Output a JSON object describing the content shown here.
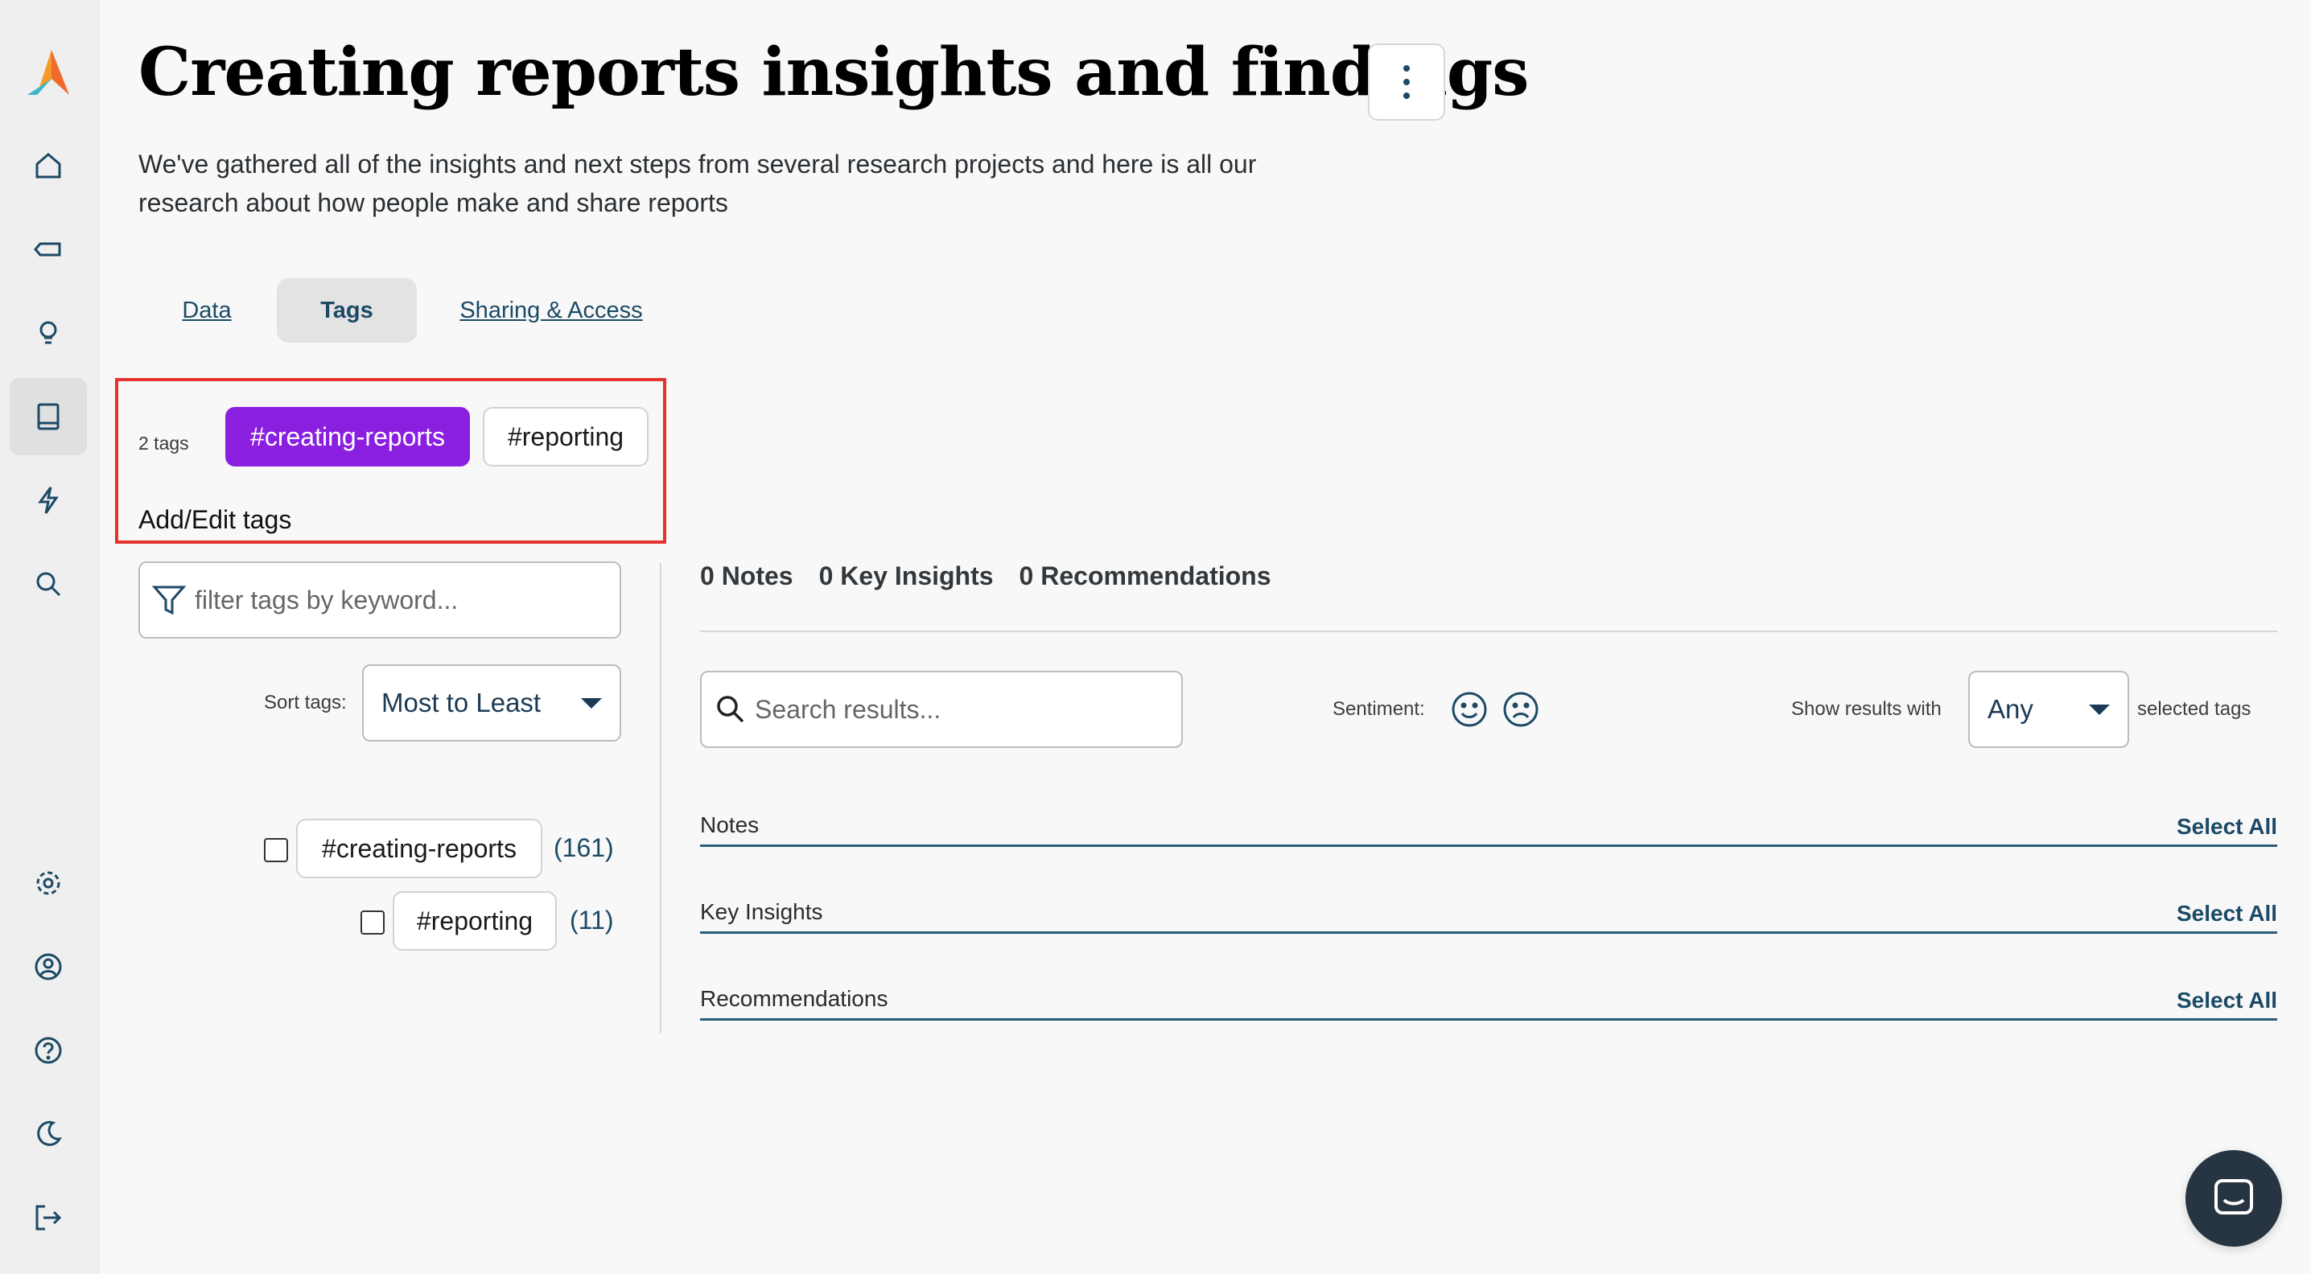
{
  "page": {
    "title": "Creating reports insights and findings",
    "description": "We've gathered all of the insights and next steps from several research projects and here is all our research about how people make and share reports"
  },
  "tabs": [
    {
      "label": "Data"
    },
    {
      "label": "Tags"
    },
    {
      "label": "Sharing & Access"
    }
  ],
  "tag_summary": {
    "count_label": "2 tags",
    "tags": [
      "#creating-reports",
      "#reporting"
    ],
    "add_edit_label": "Add/Edit tags"
  },
  "tag_filter": {
    "placeholder": "filter tags by keyword...",
    "sort_label": "Sort tags:",
    "sort_value": "Most to Least",
    "items": [
      {
        "label": "#creating-reports",
        "count": "(161)"
      },
      {
        "label": "#reporting",
        "count": "(11)"
      }
    ]
  },
  "results": {
    "stats": [
      "0 Notes",
      "0 Key Insights",
      "0 Recommendations"
    ],
    "search_placeholder": "Search results...",
    "sentiment_label": "Sentiment:",
    "show_results_label": "Show results with",
    "show_results_value": "Any",
    "selected_tags_label": "selected tags",
    "sections": [
      {
        "label": "Notes",
        "action": "Select All"
      },
      {
        "label": "Key Insights",
        "action": "Select All"
      },
      {
        "label": "Recommendations",
        "action": "Select All"
      }
    ]
  },
  "colors": {
    "accent_purple": "#8b1fe0",
    "link_blue": "#1c4a66",
    "highlight_red": "#e5322d"
  }
}
